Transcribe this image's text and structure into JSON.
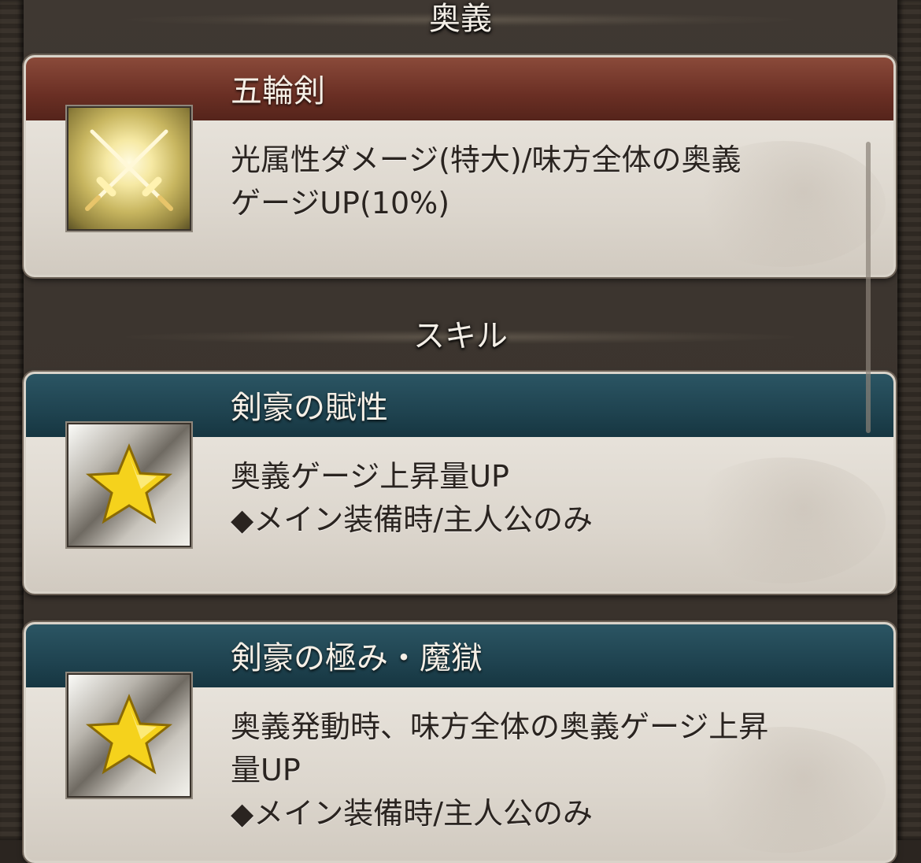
{
  "sections": {
    "ougi": {
      "header": "奥義",
      "card": {
        "title": "五輪剣",
        "icon": "crossed-swords-icon",
        "desc_line1": "光属性ダメージ(特大)/味方全体の奥義",
        "desc_line2": "ゲージUP(10%)"
      }
    },
    "skill": {
      "header": "スキル",
      "cards": [
        {
          "title": "剣豪の賦性",
          "icon": "star-icon",
          "desc_line1": "奥義ゲージ上昇量UP",
          "desc_line2": "◆メイン装備時/主人公のみ"
        },
        {
          "title": "剣豪の極み・魔獄",
          "icon": "star-icon",
          "desc_line1": "奥義発動時、味方全体の奥義ゲージ上昇",
          "desc_line2": "量UP",
          "desc_line3": "◆メイン装備時/主人公のみ"
        }
      ]
    }
  },
  "colors": {
    "ougi_title_bar": "#6a2f24",
    "skill_title_bar": "#1f4350",
    "card_body": "#e6e1da",
    "background": "#3a332c"
  }
}
